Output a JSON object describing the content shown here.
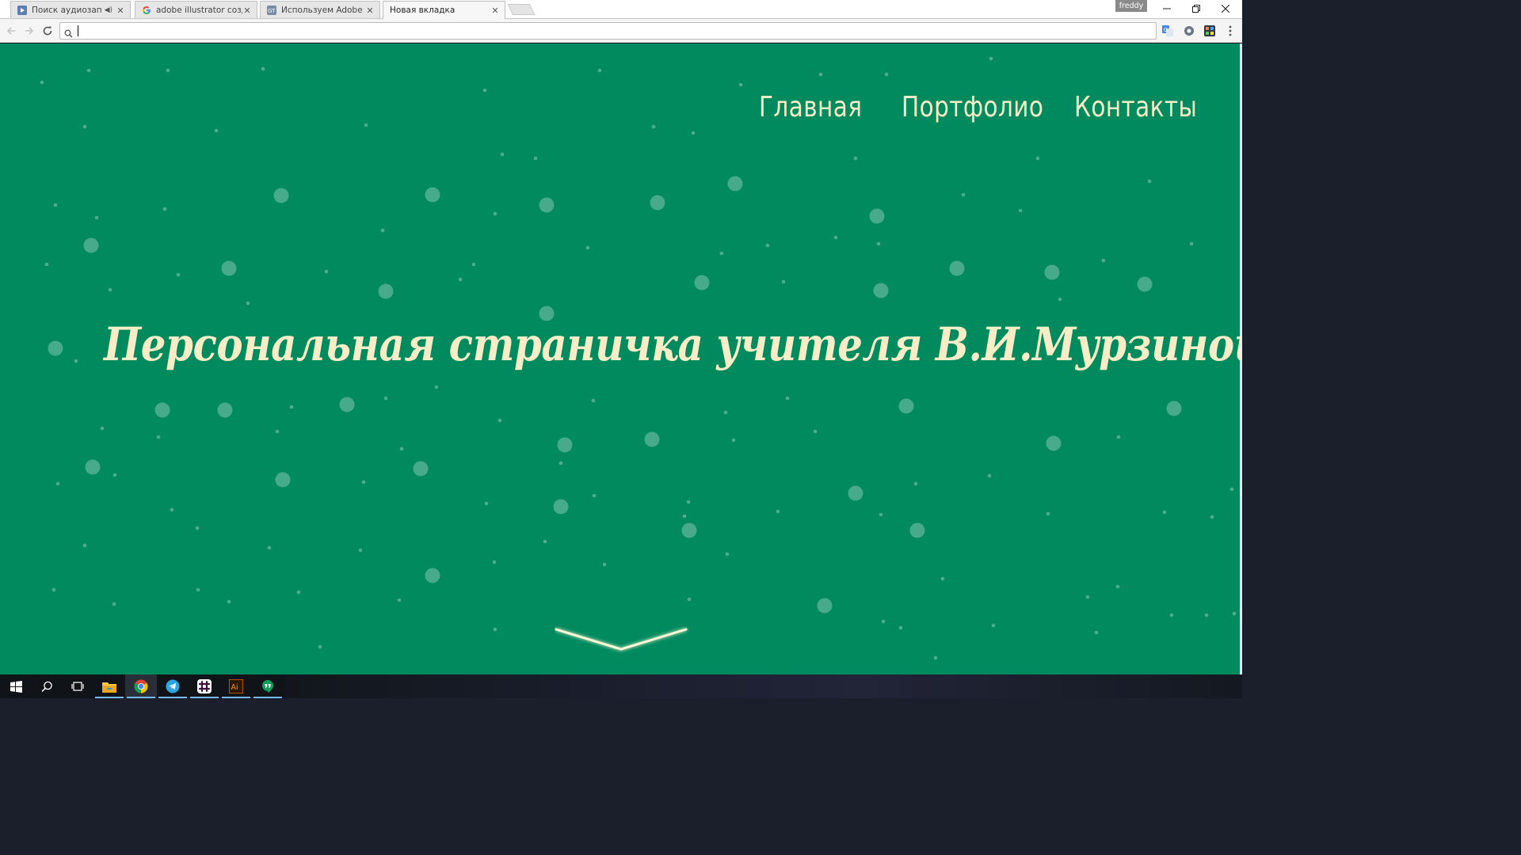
{
  "browser": {
    "tabs": [
      {
        "title": "Поиск аудиозаписей",
        "icon": "vk-audio-icon",
        "muted": true
      },
      {
        "title": "adobe illustrator создать",
        "icon": "google-icon"
      },
      {
        "title": "Используем Adobe Illust",
        "icon": "gt-site-icon"
      },
      {
        "title": "Новая вкладка",
        "icon": "",
        "active": true
      }
    ],
    "profile_name": "freddy",
    "omnibox": {
      "value": "",
      "placeholder": ""
    }
  },
  "page": {
    "background_color": "#008a5e",
    "text_color": "#f7eec8",
    "nav": [
      {
        "label": "Главная"
      },
      {
        "label": "Портфолио"
      },
      {
        "label": "Контакты"
      }
    ],
    "hero_title": "Персональная страничка учителя В.И.Мурзиной.",
    "scroll_icon": "chevron-down-icon"
  },
  "taskbar": {
    "items": [
      {
        "icon": "windows-start-icon"
      },
      {
        "icon": "search-icon"
      },
      {
        "icon": "task-view-icon"
      },
      {
        "icon": "file-explorer-icon"
      },
      {
        "icon": "chrome-icon",
        "active": true
      },
      {
        "icon": "telegram-icon"
      },
      {
        "icon": "slack-icon"
      },
      {
        "icon": "adobe-illustrator-icon",
        "label": "Ai"
      },
      {
        "icon": "hangouts-icon"
      }
    ]
  }
}
